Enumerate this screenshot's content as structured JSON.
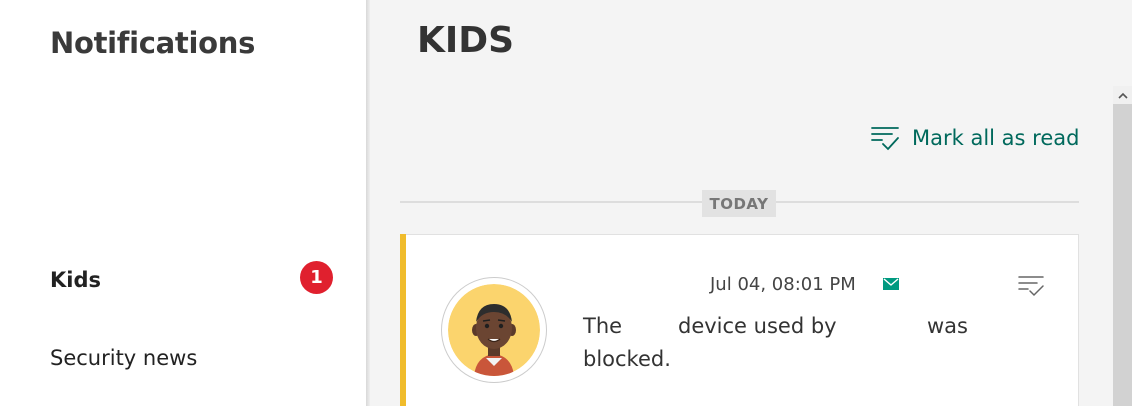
{
  "sidebar": {
    "title": "Notifications",
    "items": [
      {
        "label": "Kids",
        "badge": "1"
      },
      {
        "label": "Security news"
      }
    ]
  },
  "main": {
    "title": "KIDS",
    "mark_all_label": "Mark all as read",
    "group_label": "TODAY",
    "notification": {
      "date": "Jul 04, 08:01 PM",
      "text_parts": [
        "The",
        "device used by",
        "was",
        "blocked."
      ]
    }
  },
  "colors": {
    "accent_green": "#00695c",
    "badge_red": "#e0202e",
    "card_accent": "#f0bc2c"
  },
  "icons": {
    "mark_all": "mark-read-icon",
    "mail": "envelope-icon",
    "card_action": "mark-read-icon",
    "scroll": "chevron-up-icon"
  }
}
